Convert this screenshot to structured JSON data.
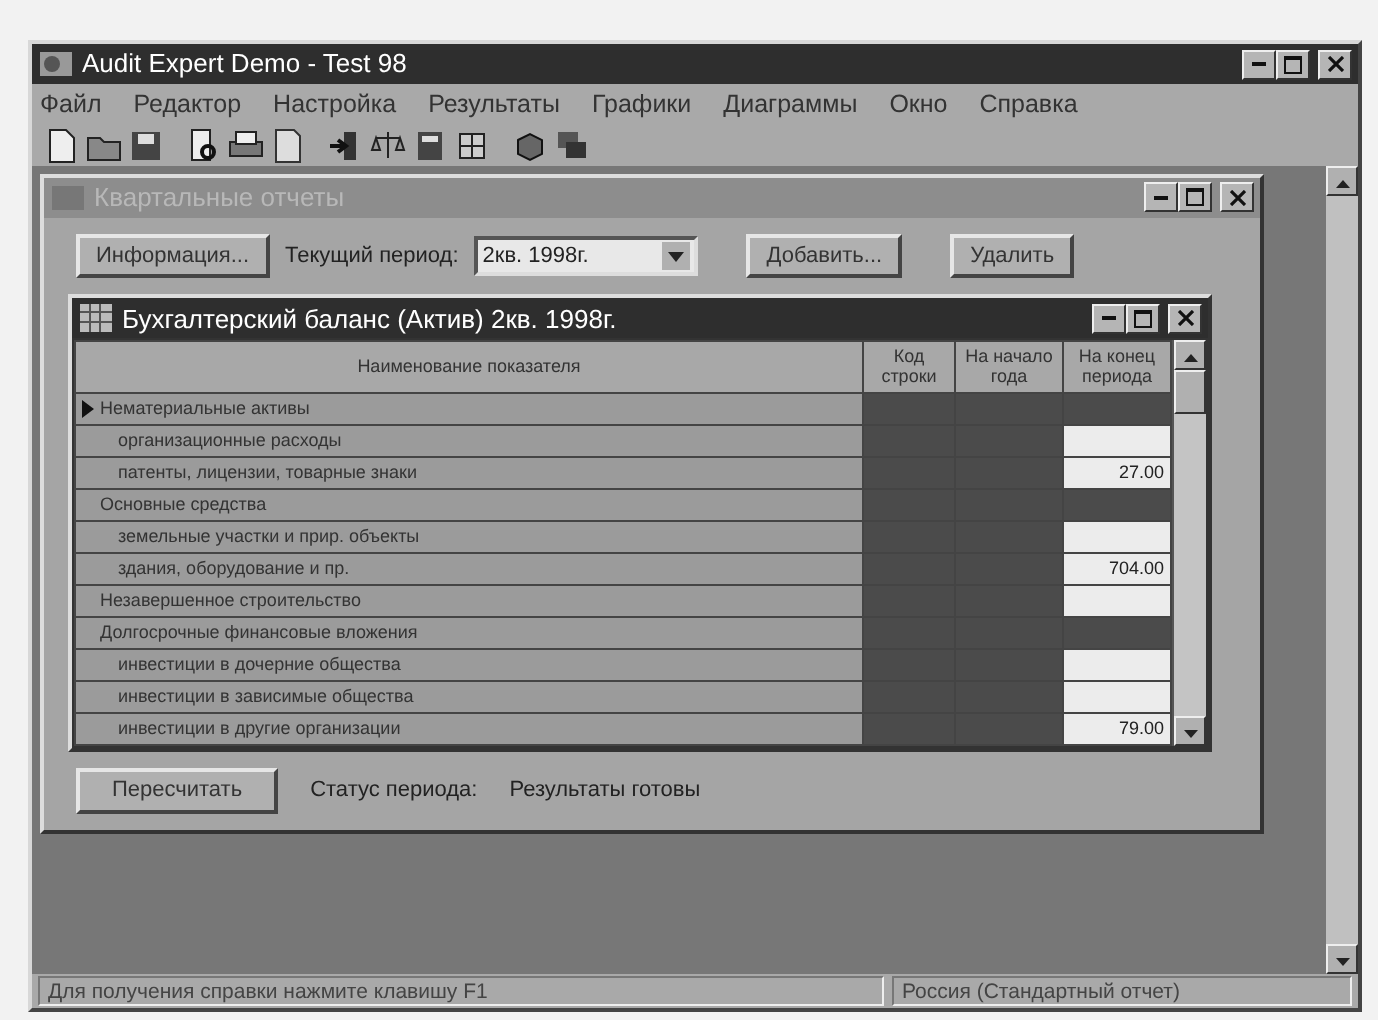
{
  "window": {
    "title": "Audit Expert Demo - Test 98"
  },
  "menu": [
    "Файл",
    "Редактор",
    "Настройка",
    "Результаты",
    "Графики",
    "Диаграммы",
    "Окно",
    "Справка"
  ],
  "child_window": {
    "title": "Квартальные отчеты",
    "active": false,
    "toolbar": {
      "info_button": "Информация...",
      "period_label": "Текущий период:",
      "period_value": "2кв. 1998г.",
      "add_button": "Добавить...",
      "delete_button": "Удалить"
    },
    "report_window": {
      "title": "Бухгалтерский баланс (Актив)   2кв. 1998г.",
      "active": true,
      "columns": [
        "Наименование показателя",
        "Код строки",
        "На начало года",
        "На конец периода"
      ],
      "rows": [
        {
          "name": "Нематериальные активы",
          "kind": "group",
          "selected": true,
          "editable": false
        },
        {
          "name": "организационные расходы",
          "kind": "item",
          "selected": false,
          "editable": true
        },
        {
          "name": "патенты, лицензии, товарные знаки",
          "kind": "item",
          "selected": false,
          "editable": true,
          "end": "27.00"
        },
        {
          "name": "Основные средства",
          "kind": "group",
          "selected": false,
          "editable": false
        },
        {
          "name": "земельные участки и прир. объекты",
          "kind": "item",
          "selected": false,
          "editable": true
        },
        {
          "name": "здания, оборудование и пр.",
          "kind": "item",
          "selected": false,
          "editable": true,
          "end": "704.00"
        },
        {
          "name": "Незавершенное строительство",
          "kind": "group",
          "selected": false,
          "editable": true
        },
        {
          "name": "Долгосрочные финансовые вложения",
          "kind": "group",
          "selected": false,
          "editable": false
        },
        {
          "name": "инвестиции в дочерние общества",
          "kind": "item",
          "selected": false,
          "editable": true
        },
        {
          "name": "инвестиции в зависимые общества",
          "kind": "item",
          "selected": false,
          "editable": true
        },
        {
          "name": "инвестиции в другие организации",
          "kind": "item",
          "selected": false,
          "editable": true,
          "end": "79.00"
        }
      ]
    },
    "recalc_button": "Пересчитать",
    "status_label": "Статус периода:",
    "status_value": "Результаты готовы"
  },
  "status_bar": [
    "Для получения справки нажмите клавишу F1",
    "Россия (Стандартный отчет)"
  ]
}
